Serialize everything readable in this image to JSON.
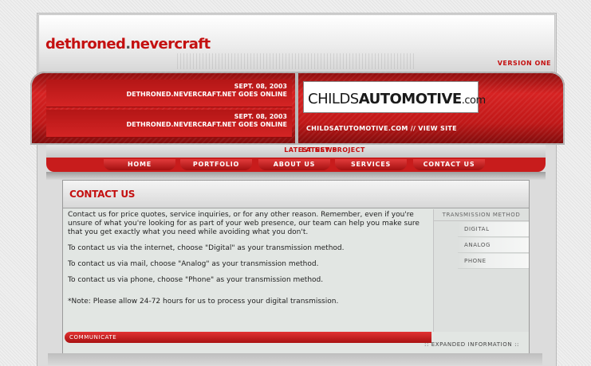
{
  "header": {
    "logo_part1": "dethroned",
    "logo_dot": ".",
    "logo_part2": "nevercraft",
    "version": "VERSION ONE"
  },
  "news": [
    {
      "date": "SEPT. 08, 2003",
      "headline": "DETHRONED.NEVERCRAFT.NET GOES ONLINE"
    },
    {
      "date": "SEPT. 08, 2003",
      "headline": "DETHRONED.NEVERCRAFT.NET GOES ONLINE"
    }
  ],
  "project": {
    "banner_text_a": "CHILDS",
    "banner_text_b": "AUTOMOTIVE",
    "banner_text_c": ".com",
    "link": "CHILDSATUTOMOTIVE.COM // VIEW SITE"
  },
  "labels": {
    "latest_news": "LATEST NEWS",
    "latest_project": "LATEST PROJECT"
  },
  "nav": [
    "HOME",
    "PORTFOLIO",
    "ABOUT US",
    "SERVICES",
    "CONTACT US"
  ],
  "content": {
    "title": "CONTACT US",
    "paragraphs": [
      "Contact us for price quotes, service inquiries, or for any other reason.  Remember, even if you're unsure of what you're looking for as part of your web presence, our team can help you make sure that you get exactly what you need while avoiding what you don't.",
      "To contact us via the internet, choose \"Digital\" as your transmission method.",
      "To contact us via mail, choose \"Analog\" as your transmission method.",
      "To contact us via phone, choose \"Phone\" as your transmission method.",
      "*Note: Please allow 24-72 hours for us to process your digital transmission."
    ]
  },
  "sidebar": {
    "heading": "TRANSMISSION METHOD",
    "items": [
      "DIGITAL",
      "ANALOG",
      "PHONE"
    ]
  },
  "footer": {
    "communicate": "COMMUNICATE",
    "expanded": ":: EXPANDED INFORMATION ::"
  },
  "colors": {
    "brand_red": "#c41010",
    "panel_bg": "#e2e6e3"
  }
}
